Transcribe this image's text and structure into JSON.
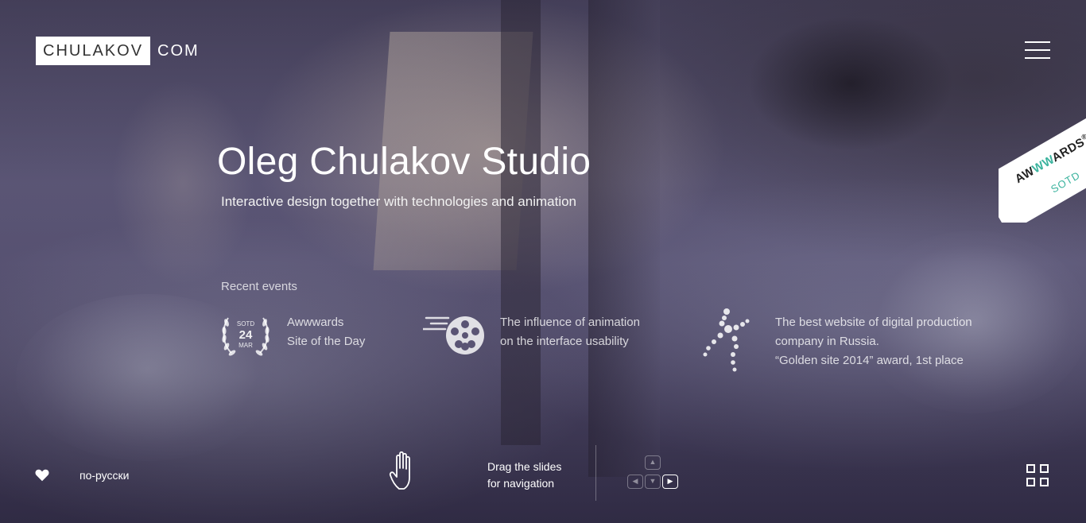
{
  "header": {
    "logo_boxed": "CHULAKOV",
    "logo_rest": "COM",
    "menu_icon": "hamburger-icon"
  },
  "ribbon": {
    "brand_prefix": "AW",
    "brand_middle": "WW",
    "brand_suffix": "ARDS",
    "registered": "®",
    "label": "SOTD",
    "accent_color": "#3bb39e"
  },
  "hero": {
    "title": "Oleg Chulakov Studio",
    "subtitle": "Interactive design together with technologies and animation"
  },
  "events": {
    "heading": "Recent events",
    "items": [
      {
        "icon": "laurel-badge-icon",
        "badge_top": "SOTD",
        "badge_day": "24",
        "badge_month": "MAR",
        "line1": "Awwwards",
        "line2": "Site of the Day"
      },
      {
        "icon": "film-reel-icon",
        "line1": "The influence of animation",
        "line2": "on the interface usability"
      },
      {
        "icon": "dancing-figure-icon",
        "line1": "The best website of digital production",
        "line2": "company in Russia.",
        "line3": "“Golden site 2014” award, 1st place"
      }
    ]
  },
  "footer": {
    "heart_icon": "heart-icon",
    "language_link": "по-русски",
    "hand_icon": "hand-icon",
    "drag_line1": "Drag the slides",
    "drag_line2": "for navigation",
    "keys": {
      "up": "▲",
      "left": "◀",
      "down": "▼",
      "right": "▶"
    },
    "grid_icon": "grid-icon"
  }
}
